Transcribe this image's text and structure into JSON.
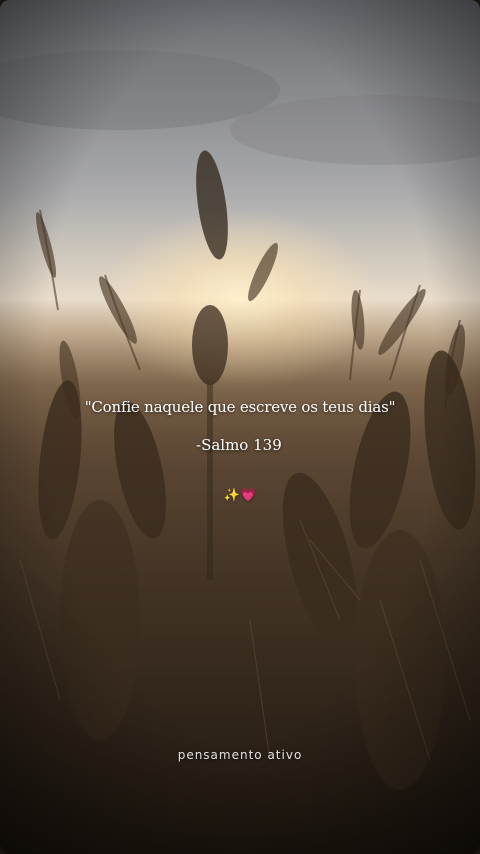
{
  "overlay": {
    "quote": "\"Confie naquele que escreve os teus dias\"",
    "reference": "-Salmo 139",
    "emoji": {
      "sparkle": "✨",
      "heart": "💗",
      "sparkle_icon": "sparkles-icon",
      "heart_icon": "pink-heart-icon"
    },
    "signature": "pensamento ativo"
  },
  "background": {
    "description_icon": "wheat-field-sunset-photo",
    "colors": {
      "sky": "#9a9ca0",
      "sun": "#fff1d2",
      "field": "#5e4a36"
    }
  }
}
